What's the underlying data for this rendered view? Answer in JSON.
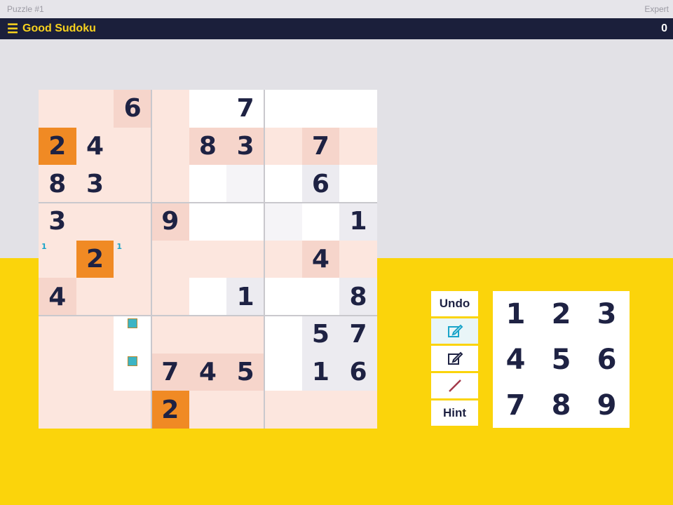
{
  "top_bar": {
    "puzzle_label": "Puzzle #1",
    "difficulty": "Expert"
  },
  "header": {
    "menu_icon": "hamburger-icon",
    "title": "Good Sudoku",
    "score": "0"
  },
  "colors": {
    "header_bg": "#1b1f3b",
    "accent_yellow": "#f7d11e",
    "selected_orange": "#f08a24",
    "highlight_peach": "#f6d5cb",
    "highlight_light": "#fce6de",
    "note_blue": "#1aa4c9"
  },
  "board": {
    "cells": [
      [
        "",
        "",
        "6",
        "",
        "",
        "7",
        "",
        "",
        ""
      ],
      [
        "2",
        "4",
        "",
        "",
        "8",
        "3",
        "",
        "7",
        ""
      ],
      [
        "8",
        "3",
        "",
        "",
        "",
        "",
        "",
        "6",
        ""
      ],
      [
        "3",
        "",
        "",
        "9",
        "",
        "",
        "",
        "",
        "1"
      ],
      [
        "",
        "2",
        "",
        "",
        "",
        "",
        "",
        "4",
        ""
      ],
      [
        "4",
        "",
        "",
        "",
        "",
        "1",
        "",
        "",
        "8"
      ],
      [
        "",
        "",
        "",
        "",
        "",
        "",
        "",
        "5",
        "7"
      ],
      [
        "",
        "",
        "",
        "7",
        "4",
        "5",
        "",
        "1",
        "6"
      ],
      [
        "",
        "",
        "",
        "2",
        "",
        "",
        "",
        "",
        ""
      ]
    ],
    "cell_styles": [
      [
        "light",
        "light",
        "peach",
        "light",
        "white",
        "white",
        "white",
        "white",
        "white"
      ],
      [
        "orange",
        "light",
        "light",
        "light",
        "peach",
        "peach",
        "light",
        "peach",
        "light"
      ],
      [
        "light",
        "light",
        "light",
        "light",
        "white",
        "lightgrey",
        "white",
        "grey",
        "white"
      ],
      [
        "light",
        "light",
        "light",
        "peach",
        "white",
        "white",
        "lightgrey",
        "white",
        "grey"
      ],
      [
        "light",
        "orange",
        "light",
        "light",
        "light",
        "light",
        "light",
        "peach",
        "light"
      ],
      [
        "peach",
        "light",
        "light",
        "light",
        "white",
        "grey",
        "white",
        "white",
        "grey"
      ],
      [
        "light",
        "light",
        "white",
        "light",
        "light",
        "light",
        "white",
        "grey",
        "grey"
      ],
      [
        "light",
        "light",
        "white",
        "peach",
        "peach",
        "peach",
        "white",
        "grey",
        "grey"
      ],
      [
        "light",
        "light",
        "light",
        "orange",
        "light",
        "light",
        "light",
        "light",
        "light"
      ]
    ],
    "notes": [
      {
        "row": 4,
        "col": 0,
        "value": "1",
        "pos": "tl"
      },
      {
        "row": 4,
        "col": 2,
        "value": "1",
        "pos": "tl"
      }
    ],
    "note_markers": [
      {
        "row": 6,
        "col": 2,
        "icon": "pencil-mark-icon"
      },
      {
        "row": 7,
        "col": 2,
        "icon": "pencil-mark-icon"
      }
    ]
  },
  "tools": {
    "undo_label": "Undo",
    "pencil_icon": "pencil-icon",
    "edit_icon": "edit-note-icon",
    "pen_icon": "pen-icon",
    "hint_label": "Hint"
  },
  "keypad": {
    "keys": [
      "1",
      "2",
      "3",
      "4",
      "5",
      "6",
      "7",
      "8",
      "9"
    ]
  }
}
